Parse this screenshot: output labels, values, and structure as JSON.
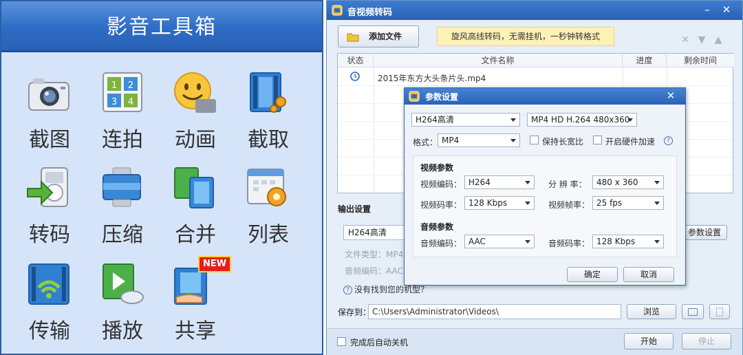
{
  "left_panel": {
    "title": "影音工具箱",
    "tiles": [
      {
        "label": "截图",
        "icon": "camera-icon"
      },
      {
        "label": "连拍",
        "icon": "burst-grid-icon"
      },
      {
        "label": "动画",
        "icon": "gif-smiley-icon"
      },
      {
        "label": "截取",
        "icon": "film-cut-icon"
      },
      {
        "label": "转码",
        "icon": "convert-arrow-icon"
      },
      {
        "label": "压缩",
        "icon": "compress-icon"
      },
      {
        "label": "合并",
        "icon": "merge-film-icon"
      },
      {
        "label": "列表",
        "icon": "calendar-gear-icon"
      },
      {
        "label": "传输",
        "icon": "wifi-film-icon"
      },
      {
        "label": "播放",
        "icon": "play-cloud-icon"
      },
      {
        "label": "共享",
        "icon": "share-hand-icon",
        "badge": "NEW"
      }
    ]
  },
  "window": {
    "title": "音视频转码",
    "add_file": "添加文件",
    "promo": "旋风高线转码，无需挂机，一秒钟转格式",
    "table": {
      "headers": [
        "状态",
        "文件名称",
        "进度",
        "剩余时间"
      ],
      "rows": [
        {
          "name": "2015年东方大头条片头.mp4"
        }
      ]
    },
    "output": {
      "label": "输出设置",
      "preset": "H264高清",
      "file_type_label": "文件类型：",
      "file_type_value": "MP4",
      "audio_codec_label": "音频编码：",
      "audio_codec_value": "AAC",
      "params_button": "参数设置",
      "help_link": "没有找到您的机型？"
    },
    "save": {
      "label": "保存到：",
      "path": "C:\\Users\\Administrator\\Videos\\",
      "browse": "浏览"
    },
    "bottom": {
      "shutdown": "完成后自动关机",
      "start": "开始",
      "stop": "停止"
    }
  },
  "dialog": {
    "title": "参数设置",
    "preset": "H264高清",
    "device": "MP4 HD H.264 480x360",
    "format_label": "格式：",
    "format_value": "MP4",
    "keep_ratio": "保持长宽比",
    "hw_accel": "开启硬件加速",
    "video_section": "视频参数",
    "video_codec_label": "视频编码：",
    "video_codec_value": "H264",
    "resolution_label": "分 辨 率：",
    "resolution_value": "480 x 360",
    "video_bitrate_label": "视频码率：",
    "video_bitrate_value": "128 Kbps",
    "fps_label": "视频帧率：",
    "fps_value": "25 fps",
    "audio_section": "音频参数",
    "audio_codec_label": "音频编码：",
    "audio_codec_value": "AAC",
    "audio_bitrate_label": "音频码率：",
    "audio_bitrate_value": "128 Kbps",
    "ok": "确定",
    "cancel": "取消"
  },
  "colors": {
    "title_blue": "#2d6cc5",
    "panel_bg": "#d5e4f8",
    "promo_bg": "#fdf1b6",
    "new_badge": "#e81c1c"
  }
}
